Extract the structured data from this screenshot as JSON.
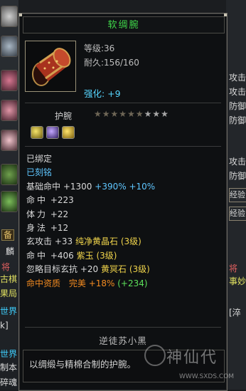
{
  "item": {
    "name": "软绸腕",
    "level_label": "等级:36",
    "durability_label": "耐久:156/160",
    "enhance_label": "强化: +9",
    "type": "护腕",
    "stars": {
      "filled": 6,
      "total": 9
    },
    "gems": [
      "yellow-gem-icon",
      "purple-gem-icon",
      "gold-gem-icon"
    ],
    "bound": "已绑定",
    "engraved": "已刻铭",
    "attributes": [
      {
        "label": "基础命中",
        "value": "+1300",
        "extra": "+390% +10%"
      },
      {
        "label": "命中",
        "value": "+223"
      },
      {
        "label": "体力",
        "value": "+22"
      },
      {
        "label": "身法",
        "value": "+12"
      },
      {
        "label": "玄攻击",
        "value": "+33",
        "gem": "纯净黄晶石 (3级)"
      },
      {
        "label": "命中",
        "value": "+406",
        "gem": "紫玉 (3级)"
      },
      {
        "label": "忽略目标玄抗",
        "value": "+20",
        "gem": "黄冥石 (3级)"
      }
    ],
    "quality": {
      "label": "命中资质",
      "grade": "完美",
      "pct": "+18%",
      "bonus": "(+234)"
    },
    "maker": "逆徒苏小黑",
    "description": "以绸缎与精棉合制的护腕。"
  },
  "background": {
    "left_texts": [
      "麟",
      "将",
      "古棋",
      "果局",
      "世界",
      "k]",
      "世界",
      "制本",
      "碎魂"
    ],
    "left_button": "备",
    "right_texts": [
      "攻击",
      "攻击",
      "防御",
      "防御",
      "攻击",
      "防御",
      "将",
      "事妙",
      "[淬"
    ],
    "right_buttons": [
      "经验",
      "经验"
    ]
  },
  "watermark": {
    "logo": "神仙代",
    "url": "WWW.SXDS.COM"
  },
  "colors": {
    "title": "#40d84a",
    "enhance": "#57d6ff",
    "gem_text": "#f0d44b",
    "quality": "#f28a20"
  }
}
